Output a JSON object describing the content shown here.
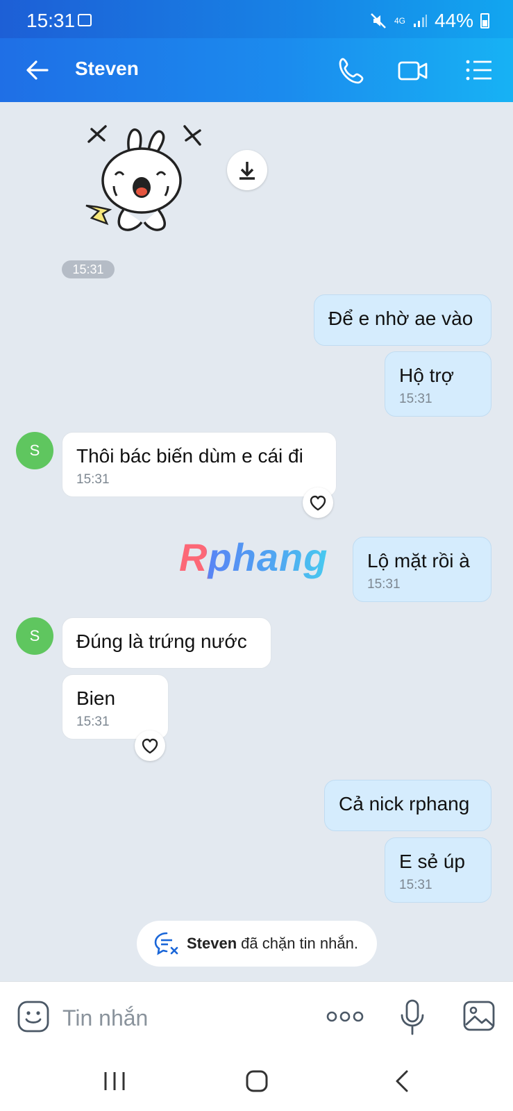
{
  "status_bar": {
    "time": "15:31",
    "network": "4G",
    "battery": "44%",
    "icons": [
      "image-icon",
      "mute-icon",
      "signal-icon",
      "battery-icon"
    ]
  },
  "header": {
    "title": "Steven",
    "icons": [
      "back-arrow-icon",
      "phone-icon",
      "video-call-icon",
      "menu-list-icon"
    ]
  },
  "chat": {
    "sticker_time": "15:31",
    "messages": [
      {
        "dir": "out",
        "text": "Để e nhờ ae vào"
      },
      {
        "dir": "out",
        "text": "Hộ trợ",
        "time": "15:31"
      },
      {
        "dir": "in",
        "avatar": "S",
        "text": "Thôi bác biến dùm e cái đi",
        "time": "15:31"
      },
      {
        "dir": "out",
        "text": "Lộ mặt rồi à",
        "time": "15:31"
      },
      {
        "dir": "in",
        "avatar": "S",
        "text": "Đúng là trứng nước"
      },
      {
        "dir": "in",
        "text": "Bien",
        "time": "15:31"
      },
      {
        "dir": "out",
        "text": "Cả nick rphang"
      },
      {
        "dir": "out",
        "text": "E sẻ úp",
        "time": "15:31"
      }
    ],
    "watermark": "Rphang",
    "block_notice": {
      "name": "Steven",
      "text": "đã chặn tin nhắn."
    }
  },
  "input": {
    "placeholder": "Tin nhắn",
    "icons": [
      "emoji-icon",
      "more-dots-icon",
      "microphone-icon",
      "gallery-icon"
    ]
  },
  "colors": {
    "header_start": "#1f6fe6",
    "header_end": "#17b2f4",
    "outgoing_bubble": "#d5ecfd",
    "incoming_bubble": "#ffffff",
    "avatar": "#5fc65f",
    "background": "#e3e9f0"
  }
}
